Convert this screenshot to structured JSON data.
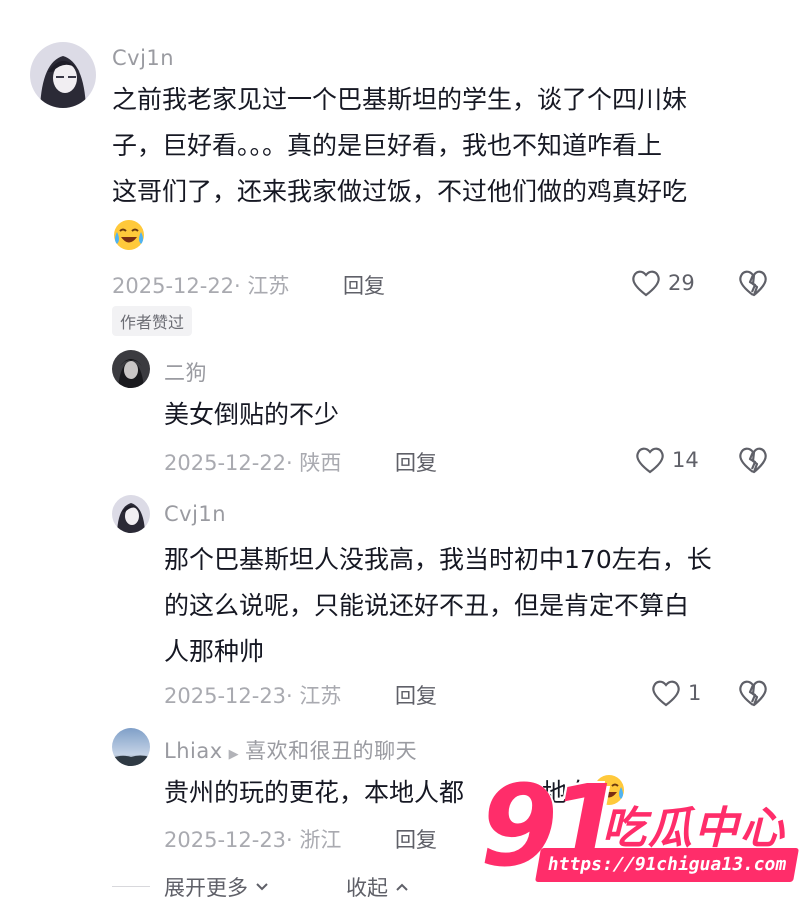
{
  "comments": [
    {
      "username": "Cvj1n",
      "lines": [
        "之前我老家见过一个巴基斯坦的学生，谈了个四川妹",
        "子，巨好看。。。真的是巨好看，我也不知道咋看上",
        "这哥们了，还来我家做过饭，不过他们做的鸡真好吃"
      ],
      "emoji": "crying-laughing-emoji",
      "date_location": "2025-12-22· 江苏",
      "reply_label": "回复",
      "likes": "29",
      "badge": "作者赞过"
    }
  ],
  "replies": [
    {
      "username": "二狗",
      "text": "美女倒贴的不少",
      "date_location": "2025-12-22· 陕西",
      "reply_label": "回复",
      "likes": "14"
    },
    {
      "username": "Cvj1n",
      "lines": [
        "那个巴基斯坦人没我高，我当时初中170左右，长",
        "的这么说呢，只能说还好不丑，但是肯定不算白",
        "人那种帅"
      ],
      "date_location": "2025-12-23· 江苏",
      "reply_label": "回复",
      "likes": "1"
    },
    {
      "username": "Lhiax",
      "reply_to": "喜欢和很丑的聊天",
      "text": "贵州的玩的更花，本地人都",
      "text_tail": "地女",
      "date_location": "2025-12-23· 浙江",
      "reply_label": "回复"
    }
  ],
  "footer": {
    "expand_label": "展开更多",
    "collapse_label": "收起"
  },
  "watermark": {
    "number": "91",
    "title": "吃瓜中心",
    "url": "https://91chigua13.com"
  },
  "colors": {
    "text": "#161823",
    "muted": "#a9aab0",
    "watermark": "#ff2d6a"
  }
}
